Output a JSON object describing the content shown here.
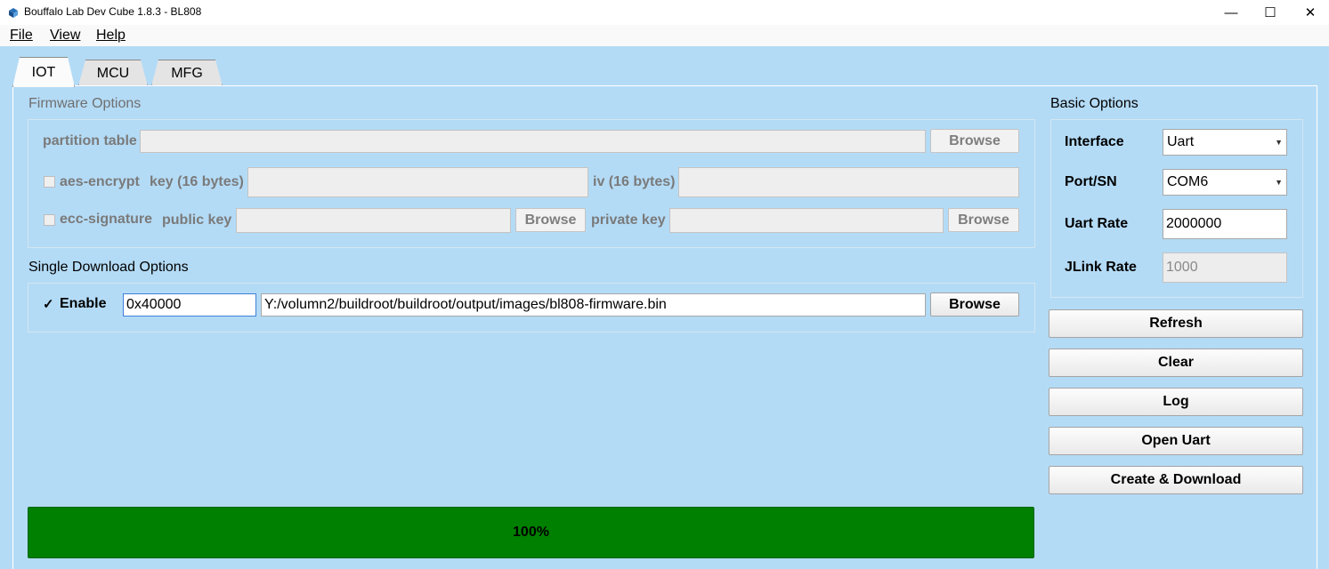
{
  "window": {
    "title": "Bouffalo Lab Dev Cube 1.8.3 - BL808",
    "controls": {
      "minimize": "—",
      "maximize": "☐",
      "close": "✕"
    }
  },
  "menu": {
    "file": "File",
    "view": "View",
    "help": "Help"
  },
  "tabs": [
    {
      "label": "IOT",
      "active": true
    },
    {
      "label": "MCU",
      "active": false
    },
    {
      "label": "MFG",
      "active": false
    }
  ],
  "firmware_options": {
    "heading": "Firmware Options",
    "partition_table": {
      "label": "partition table",
      "value": "",
      "browse": "Browse"
    },
    "aes_encrypt": {
      "label": "aes-encrypt",
      "checked": false,
      "key_label": "key (16 bytes)",
      "key_value": "",
      "iv_label": "iv (16 bytes)",
      "iv_value": ""
    },
    "ecc_signature": {
      "label": "ecc-signature",
      "checked": false,
      "public_key_label": "public key",
      "public_key_browse": "Browse",
      "private_key_label": "private key",
      "private_key_browse": "Browse"
    }
  },
  "single_download": {
    "heading": "Single Download Options",
    "enable_label": "Enable",
    "enable_check": "✓",
    "enabled": true,
    "address": "0x40000",
    "file_path": "Y:/volumn2/buildroot/buildroot/output/images/bl808-firmware.bin",
    "browse": "Browse"
  },
  "basic_options": {
    "heading": "Basic Options",
    "interface": {
      "label": "Interface",
      "value": "Uart"
    },
    "port": {
      "label": "Port/SN",
      "value": "COM6"
    },
    "uart_rate": {
      "label": "Uart Rate",
      "value": "2000000"
    },
    "jlink_rate": {
      "label": "JLink Rate",
      "value": "1000"
    }
  },
  "actions": {
    "refresh": "Refresh",
    "clear": "Clear",
    "log": "Log",
    "open_uart": "Open Uart",
    "create_download": "Create & Download"
  },
  "progress": {
    "percent": 100,
    "label": "100%"
  },
  "colors": {
    "background": "#b4dbf6",
    "progress": "#008000",
    "titlebar": "#ffffff"
  },
  "icons": {
    "app": "cube-icon",
    "dropdown": "chevron-down-icon"
  }
}
